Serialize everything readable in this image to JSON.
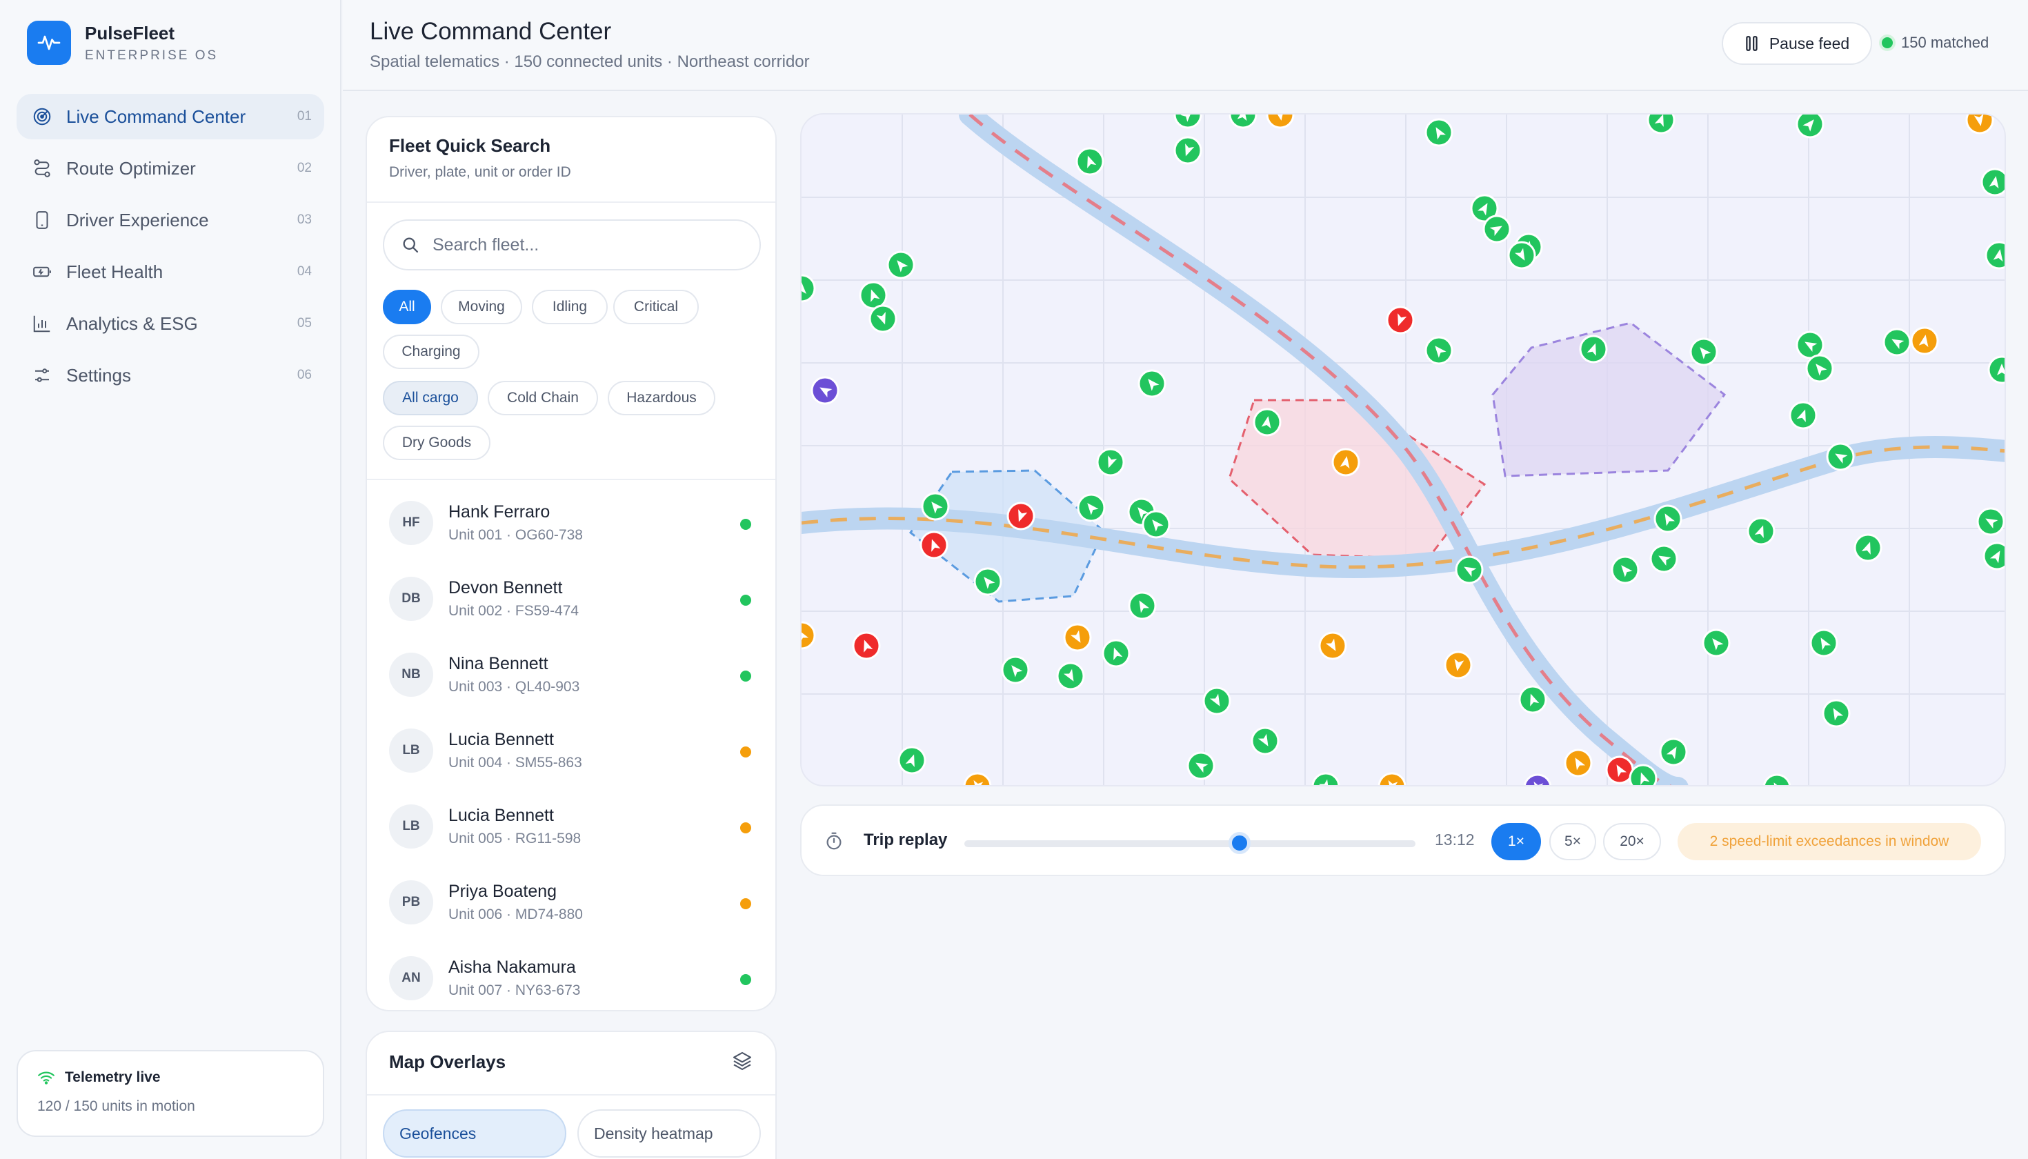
{
  "brand": {
    "name": "PulseFleet",
    "subtitle": "ENTERPRISE OS"
  },
  "nav": [
    {
      "label": "Live Command Center",
      "num": "01",
      "icon": "radar-icon",
      "active": true
    },
    {
      "label": "Route Optimizer",
      "num": "02",
      "icon": "route-icon"
    },
    {
      "label": "Driver Experience",
      "num": "03",
      "icon": "phone-icon"
    },
    {
      "label": "Fleet Health",
      "num": "04",
      "icon": "battery-icon"
    },
    {
      "label": "Analytics & ESG",
      "num": "05",
      "icon": "bar-chart-icon"
    },
    {
      "label": "Settings",
      "num": "06",
      "icon": "sliders-icon"
    }
  ],
  "telemetry": {
    "title": "Telemetry live",
    "detail": "120 / 150 units in motion"
  },
  "header": {
    "title": "Live Command Center",
    "subtitle": "Spatial telematics · 150 connected units · Northeast corridor",
    "pause_label": "Pause feed",
    "matched_label": "150 matched"
  },
  "search_panel": {
    "title": "Fleet Quick Search",
    "subtitle": "Driver, plate, unit or order ID",
    "placeholder": "Search fleet...",
    "status_filters": [
      "All",
      "Moving",
      "Idling",
      "Critical",
      "Charging"
    ],
    "cargo_filters": [
      "All cargo",
      "Cold Chain",
      "Hazardous",
      "Dry Goods"
    ]
  },
  "drivers": [
    {
      "initials": "HF",
      "name": "Hank Ferraro",
      "unit": "Unit 001 · OG60-738",
      "status": "moving"
    },
    {
      "initials": "DB",
      "name": "Devon Bennett",
      "unit": "Unit 002 · FS59-474",
      "status": "moving"
    },
    {
      "initials": "NB",
      "name": "Nina Bennett",
      "unit": "Unit 003 · QL40-903",
      "status": "moving"
    },
    {
      "initials": "LB",
      "name": "Lucia Bennett",
      "unit": "Unit 004 · SM55-863",
      "status": "idling"
    },
    {
      "initials": "LB",
      "name": "Lucia Bennett",
      "unit": "Unit 005 · RG11-598",
      "status": "idling"
    },
    {
      "initials": "PB",
      "name": "Priya Boateng",
      "unit": "Unit 006 · MD74-880",
      "status": "idling"
    },
    {
      "initials": "AN",
      "name": "Aisha Nakamura",
      "unit": "Unit 007 · NY63-673",
      "status": "moving"
    }
  ],
  "overlays": {
    "title": "Map Overlays",
    "options": [
      "Geofences",
      "Density heatmap"
    ]
  },
  "replay": {
    "label": "Trip replay",
    "time": "13:12",
    "position": 0.61,
    "speeds": [
      "1×",
      "5×",
      "20×"
    ],
    "alert": "2 speed-limit exceedances in window"
  },
  "colors": {
    "accent": "#1a7cf0",
    "moving": "#22c55e",
    "idling": "#f59e0b",
    "critical": "#ef2b2b",
    "charging": "#6c4fd6"
  }
}
